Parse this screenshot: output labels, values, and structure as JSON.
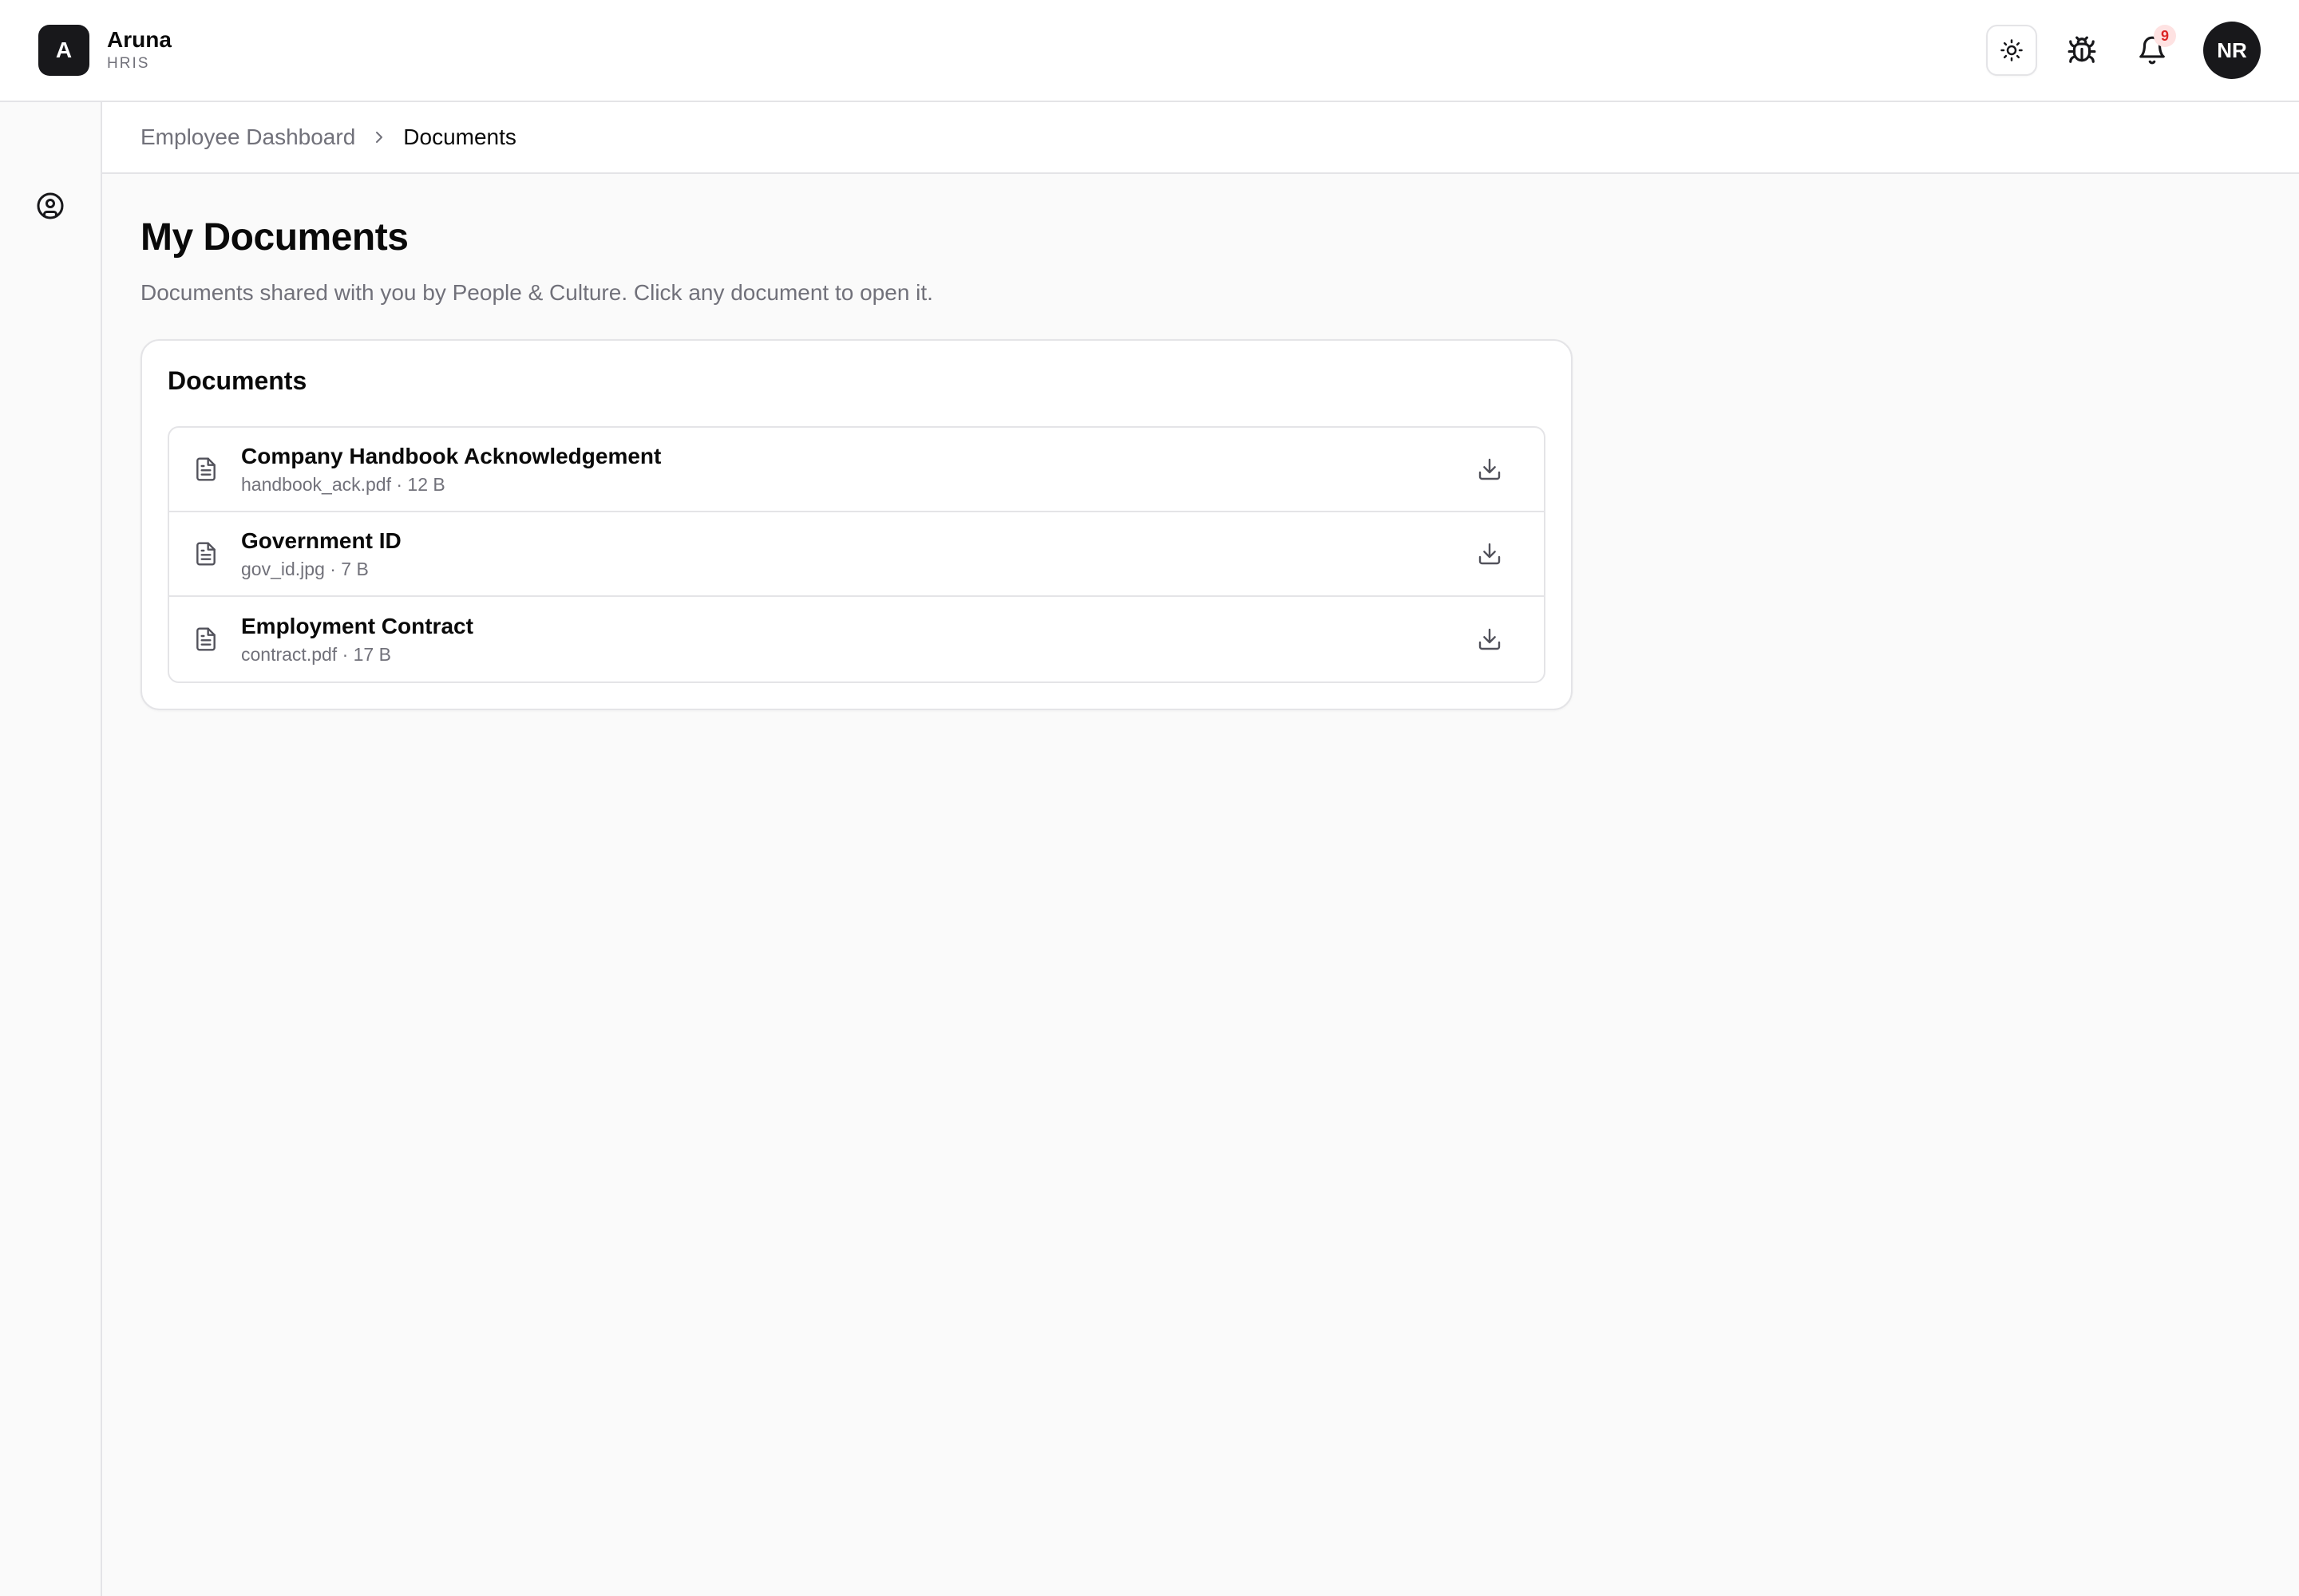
{
  "brand": {
    "logo_letter": "A",
    "name": "Aruna",
    "subtitle": "HRIS"
  },
  "header": {
    "notifications_count": "9",
    "avatar_initials": "NR"
  },
  "breadcrumb": {
    "parent": "Employee Dashboard",
    "current": "Documents"
  },
  "page": {
    "title": "My Documents",
    "subtitle": "Documents shared with you by People & Culture. Click any document to open it."
  },
  "card": {
    "title": "Documents",
    "documents": [
      {
        "name": "Company Handbook Acknowledgement",
        "meta": "handbook_ack.pdf · 12 B"
      },
      {
        "name": "Government ID",
        "meta": "gov_id.jpg · 7 B"
      },
      {
        "name": "Employment Contract",
        "meta": "contract.pdf · 17 B"
      }
    ]
  },
  "icons": {
    "theme_toggle": "sun-icon",
    "debug": "bug-icon",
    "notifications": "bell-icon",
    "sidebar_profile": "user-circle-icon",
    "document": "file-text-icon",
    "download": "download-icon",
    "breadcrumb_separator": "chevron-right-icon"
  },
  "colors": {
    "accent": "#18181b",
    "badge_bg": "#fee2e2",
    "badge_text": "#dc2626",
    "muted": "#71717a",
    "border": "#e4e4e7"
  }
}
